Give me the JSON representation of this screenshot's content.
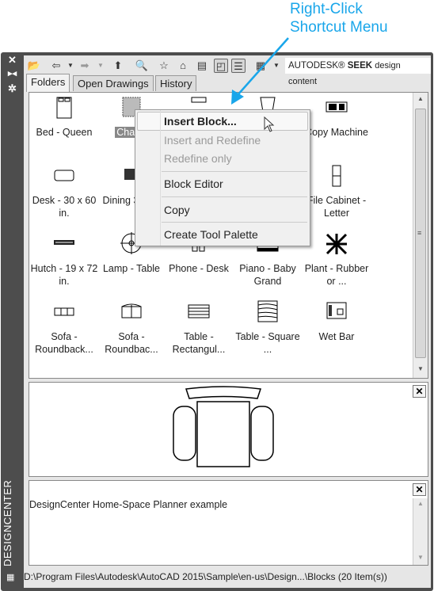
{
  "callout": {
    "line1": "Right-Click",
    "line2": "Shortcut Menu",
    "color": "#19a6ea"
  },
  "side": {
    "close_icon": "close-icon",
    "autohide_icon": "autohide-icon",
    "properties_icon": "gear-icon",
    "title": "DESIGNCENTER"
  },
  "toolbar": {
    "icons": [
      "load-icon",
      "back-icon",
      "dropdown-icon",
      "forward-icon",
      "dropdown-icon",
      "up-icon",
      "search-icon",
      "favorites-icon",
      "home-icon",
      "tree-view-toggle-icon",
      "preview-icon",
      "description-icon",
      "views-icon",
      "dropdown-icon"
    ],
    "seek_brand": "AUTODESK®",
    "seek_bold": "SEEK",
    "seek_rest": "design content"
  },
  "tabs": [
    "Folders",
    "Open Drawings",
    "History"
  ],
  "items": [
    {
      "label": "Bed - Queen"
    },
    {
      "label": "Chair -",
      "selected": true
    },
    {
      "label": ""
    },
    {
      "label": ""
    },
    {
      "label": "Copy Machine"
    },
    {
      "label": "Desk - 30 x 60 in."
    },
    {
      "label": "Dining 36 x 7"
    },
    {
      "label": ""
    },
    {
      "label": ""
    },
    {
      "label": "File Cabinet - Letter"
    },
    {
      "label": "Hutch - 19 x 72 in."
    },
    {
      "label": "Lamp - Table"
    },
    {
      "label": "Phone - Desk"
    },
    {
      "label": "Piano - Baby Grand"
    },
    {
      "label": "Plant - Rubber or ..."
    },
    {
      "label": "Sofa - Roundback..."
    },
    {
      "label": "Sofa - Roundbac..."
    },
    {
      "label": "Table - Rectangul..."
    },
    {
      "label": "Table - Square ..."
    },
    {
      "label": "Wet Bar"
    }
  ],
  "menu": {
    "items": [
      {
        "label": "Insert Block...",
        "bold": true
      },
      {
        "label": "Insert and Redefine",
        "disabled": true
      },
      {
        "label": "Redefine only",
        "disabled": true
      },
      {
        "label": "Block Editor"
      },
      {
        "label": "Copy"
      },
      {
        "label": "Create Tool Palette"
      }
    ]
  },
  "description": "DesignCenter Home-Space Planner example",
  "status": "D:\\Program Files\\Autodesk\\AutoCAD 2015\\Sample\\en-us\\Design...\\Blocks (20 Item(s))"
}
